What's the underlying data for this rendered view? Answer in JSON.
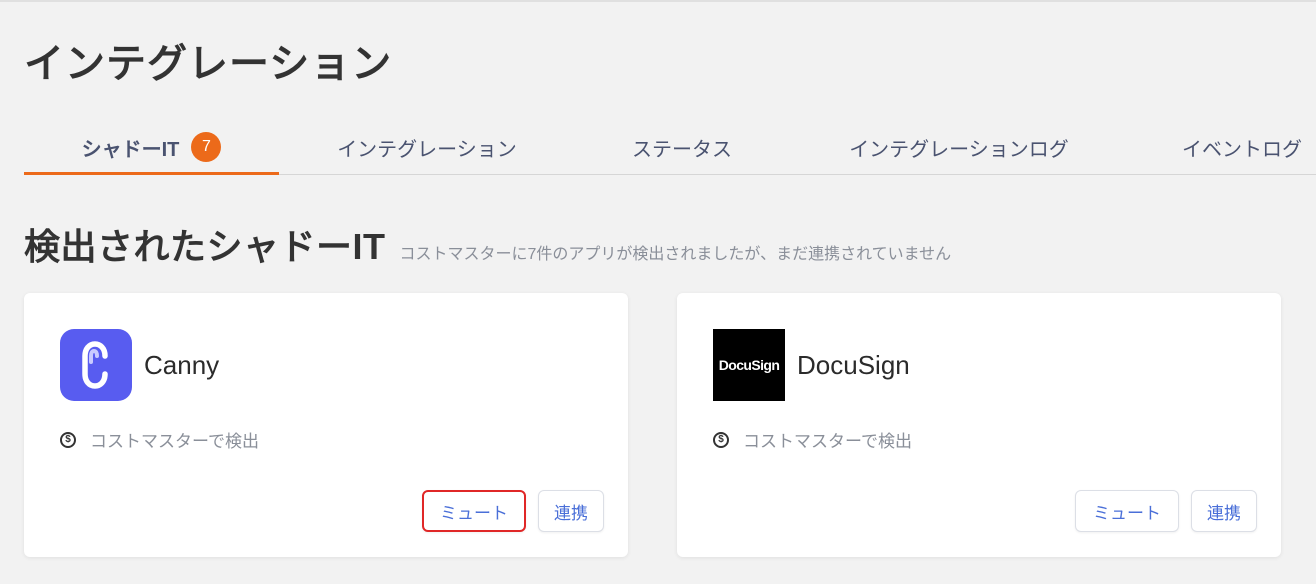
{
  "page": {
    "title": "インテグレーション"
  },
  "tabs": [
    {
      "label": "シャドーIT",
      "badge": "7",
      "active": true
    },
    {
      "label": "インテグレーション",
      "active": false
    },
    {
      "label": "ステータス",
      "active": false
    },
    {
      "label": "インテグレーションログ",
      "active": false
    },
    {
      "label": "イベントログ",
      "active": false
    }
  ],
  "section": {
    "title": "検出されたシャドーIT",
    "subtitle": "コストマスターに7件のアプリが検出されましたが、まだ連携されていません"
  },
  "cards": [
    {
      "name": "Canny",
      "logo": "canny-logo",
      "detected_by": "コストマスターで検出",
      "mute_label": "ミュート",
      "link_label": "連携",
      "mute_highlighted": true
    },
    {
      "name": "DocuSign",
      "logo": "docusign-logo",
      "logo_text": "DocuSign",
      "detected_by": "コストマスターで検出",
      "mute_label": "ミュート",
      "link_label": "連携",
      "mute_highlighted": false
    }
  ],
  "icons": {
    "detect_icon": "dollar-circle-icon",
    "detect_glyph": "$"
  },
  "colors": {
    "accent": "#ec6a1a",
    "canny_brand": "#585cf0",
    "button_text": "#4a6fd8",
    "highlight_border": "#e02727"
  }
}
